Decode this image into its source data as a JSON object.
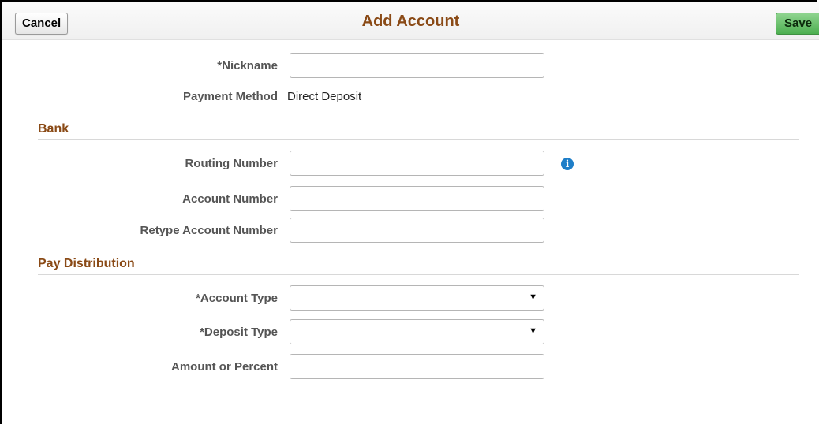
{
  "header": {
    "cancel_label": "Cancel",
    "title": "Add Account",
    "save_label": "Save"
  },
  "fields": {
    "nickname": {
      "label": "*Nickname",
      "value": ""
    },
    "payment_method": {
      "label": "Payment Method",
      "value": "Direct Deposit"
    }
  },
  "bank": {
    "title": "Bank",
    "routing_number": {
      "label": "Routing Number",
      "value": "",
      "info_icon": "info-icon"
    },
    "account_number": {
      "label": "Account Number",
      "value": ""
    },
    "retype_account_number": {
      "label": "Retype Account Number",
      "value": ""
    }
  },
  "pay_distribution": {
    "title": "Pay Distribution",
    "account_type": {
      "label": "*Account Type",
      "selected": ""
    },
    "deposit_type": {
      "label": "*Deposit Type",
      "selected": ""
    },
    "amount_or_percent": {
      "label": "Amount or Percent",
      "value": ""
    }
  },
  "colors": {
    "title": "#8a4a16",
    "save_button": "#4caf50",
    "info_icon": "#1e7ec8",
    "label": "#555555"
  }
}
